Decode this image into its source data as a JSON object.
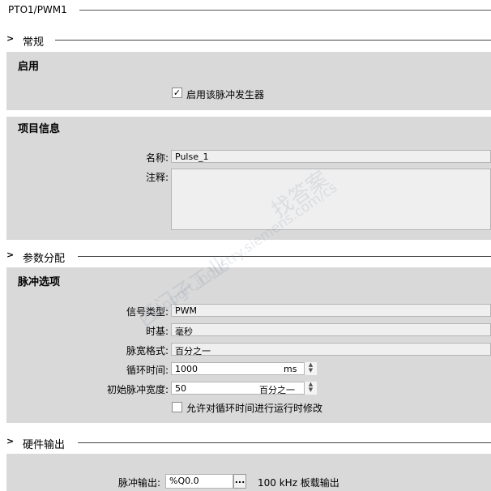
{
  "title": "PTO1/PWM1",
  "sections": {
    "general": {
      "arrow": ">",
      "label": "常规"
    },
    "params": {
      "arrow": ">",
      "label": "参数分配"
    },
    "hardware": {
      "arrow": ">",
      "label": "硬件输出"
    }
  },
  "enable": {
    "title": "启用",
    "checkbox_label": "启用该脉冲发生器",
    "checked": true,
    "check_glyph": "✓"
  },
  "project_info": {
    "title": "项目信息",
    "name_label": "名称:",
    "name_value": "Pulse_1",
    "comment_label": "注释:",
    "comment_value": ""
  },
  "pulse_options": {
    "title": "脉冲选项",
    "signal_type_label": "信号类型:",
    "signal_type_value": "PWM",
    "time_base_label": "时基:",
    "time_base_value": "毫秒",
    "pulse_format_label": "脉宽格式:",
    "pulse_format_value": "百分之一",
    "cycle_time_label": "循环时间:",
    "cycle_time_value": "1000",
    "cycle_time_unit": "ms",
    "init_width_label": "初始脉冲宽度:",
    "init_width_value": "50",
    "init_width_unit": "百分之一",
    "allow_runtime_label": "允许对循环时间进行运行时修改",
    "allow_runtime_checked": false
  },
  "hardware_output": {
    "pulse_output_label": "脉冲输出:",
    "pulse_output_value": "%Q0.0",
    "browse_label": "...",
    "pulse_output_desc": "100 kHz 板载输出"
  },
  "spinner": {
    "up": "▲",
    "down": "▼"
  },
  "watermark": {
    "line1": "西门子工业",
    "line2": "support.industry.siemens.com/cs",
    "line3": "找答案"
  }
}
